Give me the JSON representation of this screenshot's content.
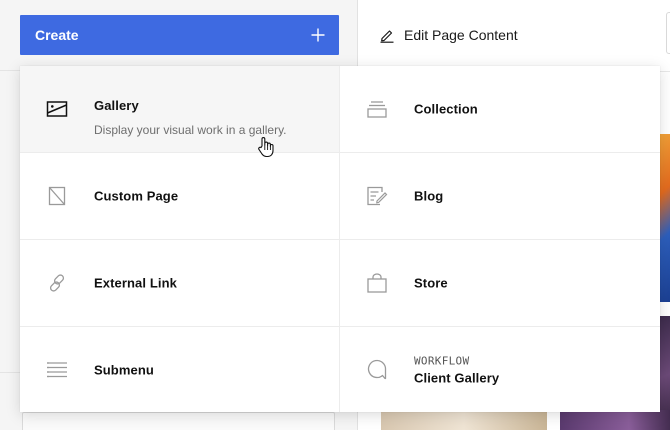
{
  "sidebar": {
    "create_button": {
      "label": "Create",
      "icon": "plus-icon"
    }
  },
  "header": {
    "edit_page_content": {
      "label": "Edit Page Content",
      "icon": "pencil-icon"
    }
  },
  "create_menu": {
    "hovered_item": "gallery",
    "items": [
      {
        "id": "gallery",
        "label": "Gallery",
        "description": "Display your visual work in a gallery.",
        "icon": "gallery-image-icon"
      },
      {
        "id": "collection",
        "label": "Collection",
        "icon": "collection-stack-icon"
      },
      {
        "id": "custom-page",
        "label": "Custom Page",
        "icon": "custom-page-icon"
      },
      {
        "id": "blog",
        "label": "Blog",
        "icon": "blog-edit-icon"
      },
      {
        "id": "external-link",
        "label": "External Link",
        "icon": "link-icon"
      },
      {
        "id": "store",
        "label": "Store",
        "icon": "shopping-bag-icon"
      },
      {
        "id": "submenu",
        "label": "Submenu",
        "icon": "list-lines-icon"
      },
      {
        "id": "client-gallery",
        "eyebrow": "WORKFLOW",
        "label": "Client Gallery",
        "icon": "speech-bubble-icon"
      }
    ]
  },
  "colors": {
    "accent": "#3e6ae1",
    "menu_hover_bg": "#f6f6f6",
    "icon_gray": "#9a9a9a"
  }
}
